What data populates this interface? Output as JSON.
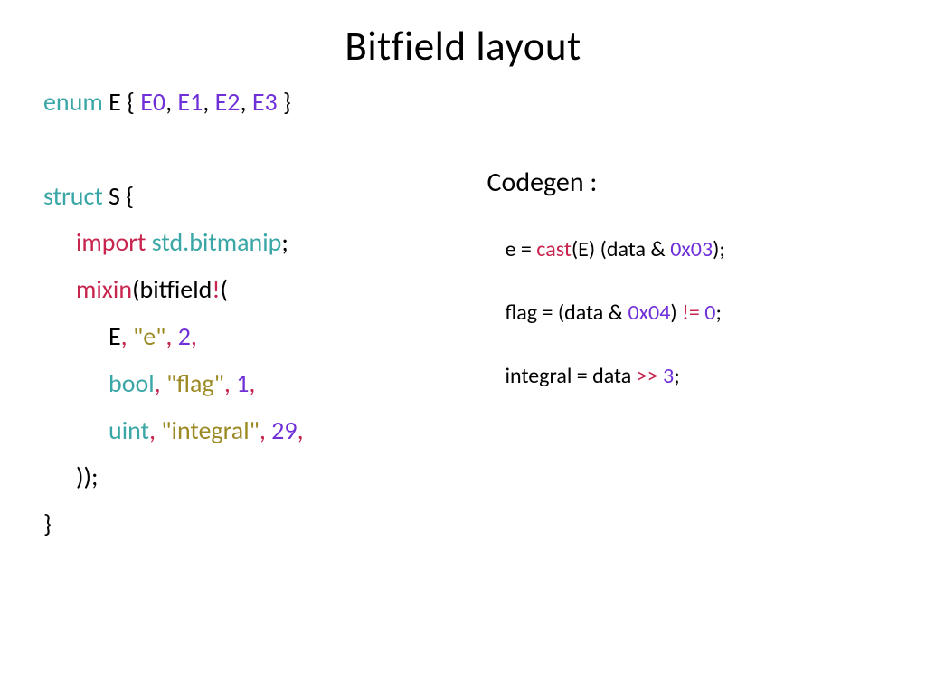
{
  "title": "Bitfield layout",
  "left": {
    "l1": {
      "kw": "enum",
      "name": " E { ",
      "e0": "E0",
      "e1": "E1",
      "e2": "E2",
      "e3": "E3",
      "close": " }"
    },
    "l2": {
      "kw": "struct",
      "name": " S {"
    },
    "l3": {
      "kw": "import",
      "mod": " std.bitmanip",
      "semi": ";"
    },
    "l4": {
      "kw": "mixin",
      "p1": "(bitfield",
      "bang": "!",
      "p2": "("
    },
    "l5": {
      "t": "E",
      "c1": ",",
      "s": " \"e\"",
      "c2": ",",
      "n": " 2",
      "c3": ","
    },
    "l6": {
      "t": "bool",
      "c1": ",",
      "s": " \"flag\"",
      "c2": ",",
      "n": " 1",
      "c3": ","
    },
    "l7": {
      "t": "uint",
      "c1": ",",
      "s": " \"integral\"",
      "c2": ",",
      "n": " 29",
      "c3": ","
    },
    "l8": {
      "close": "));"
    },
    "l9": {
      "brace": "}"
    }
  },
  "right": {
    "heading": "Codegen :",
    "r1": {
      "a": "e = ",
      "cast": "cast",
      "b": "(E) (data & ",
      "hex": "0x03",
      "c": ");"
    },
    "r2": {
      "a": "flag = (data & ",
      "hex": "0x04",
      "b": ") ",
      "ne": "!=",
      "c": " 0",
      "d": ";"
    },
    "r3": {
      "a": "integral = data ",
      "op": ">>",
      "b": " 3",
      "c": ";"
    }
  }
}
